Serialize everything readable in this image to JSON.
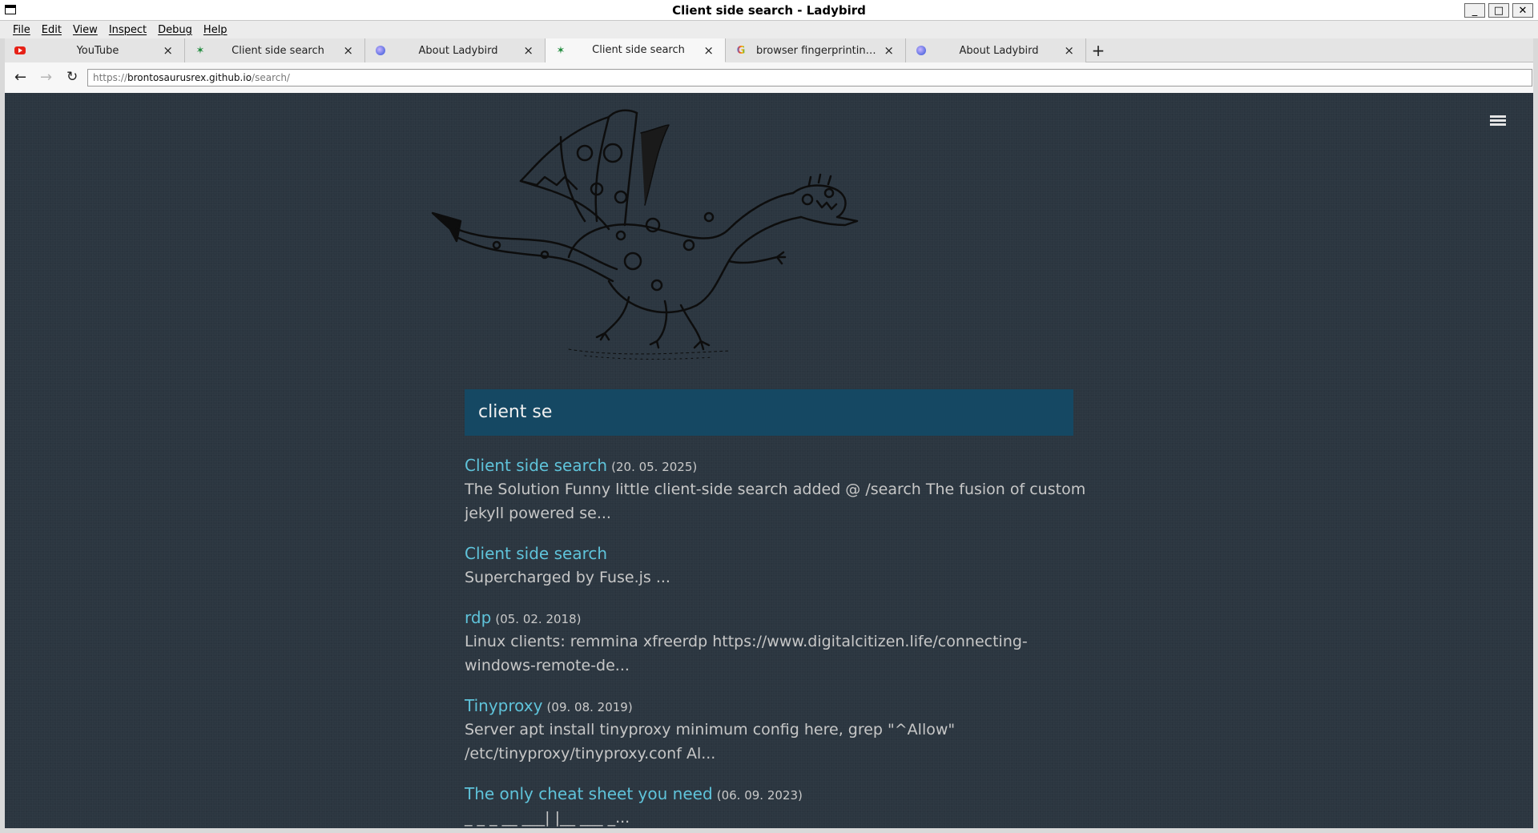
{
  "window": {
    "title": "Client side search - Ladybird",
    "buttons": {
      "minimize": "_",
      "maximize": "□",
      "close": "✕"
    }
  },
  "menu": [
    "File",
    "Edit",
    "View",
    "Inspect",
    "Debug",
    "Help"
  ],
  "tabs": [
    {
      "label": "YouTube",
      "icon": "youtube-icon",
      "active": false
    },
    {
      "label": "Client side search",
      "icon": "star-icon",
      "active": false
    },
    {
      "label": "About Ladybird",
      "icon": "ladybird-icon",
      "active": false
    },
    {
      "label": "Client side search",
      "icon": "star-icon",
      "active": true
    },
    {
      "label": "browser fingerprinting t...",
      "icon": "google-icon",
      "active": false
    },
    {
      "label": "About Ladybird",
      "icon": "ladybird-icon",
      "active": false
    }
  ],
  "tab_close": "×",
  "new_tab": "+",
  "nav": {
    "back": "←",
    "forward": "→",
    "reload": "↻"
  },
  "url": {
    "scheme": "https://",
    "host": "brontosaurusrex.github.io",
    "path": "/search/"
  },
  "page": {
    "search_value": "client se",
    "results": [
      {
        "title": "Client side search",
        "date": "(20. 05. 2025)",
        "snippet": "The Solution Funny little client-side search added @ /search The fusion of custom jekyll powered se..."
      },
      {
        "title": "Client side search",
        "date": "",
        "snippet": "Supercharged by Fuse.js ..."
      },
      {
        "title": "rdp",
        "date": "(05. 02. 2018)",
        "snippet": "Linux clients: remmina xfreerdp https://www.digitalcitizen.life/connecting-windows-remote-de..."
      },
      {
        "title": "Tinyproxy",
        "date": "(09. 08. 2019)",
        "snippet": "Server apt install tinyproxy minimum config here, grep \"^Allow\" /etc/tinyproxy/tinyproxy.conf Al..."
      },
      {
        "title": "The only cheat sheet you need",
        "date": "(06. 09. 2023)",
        "snippet": "_ _ _ __ ___| |__ ___ _..."
      }
    ]
  }
}
